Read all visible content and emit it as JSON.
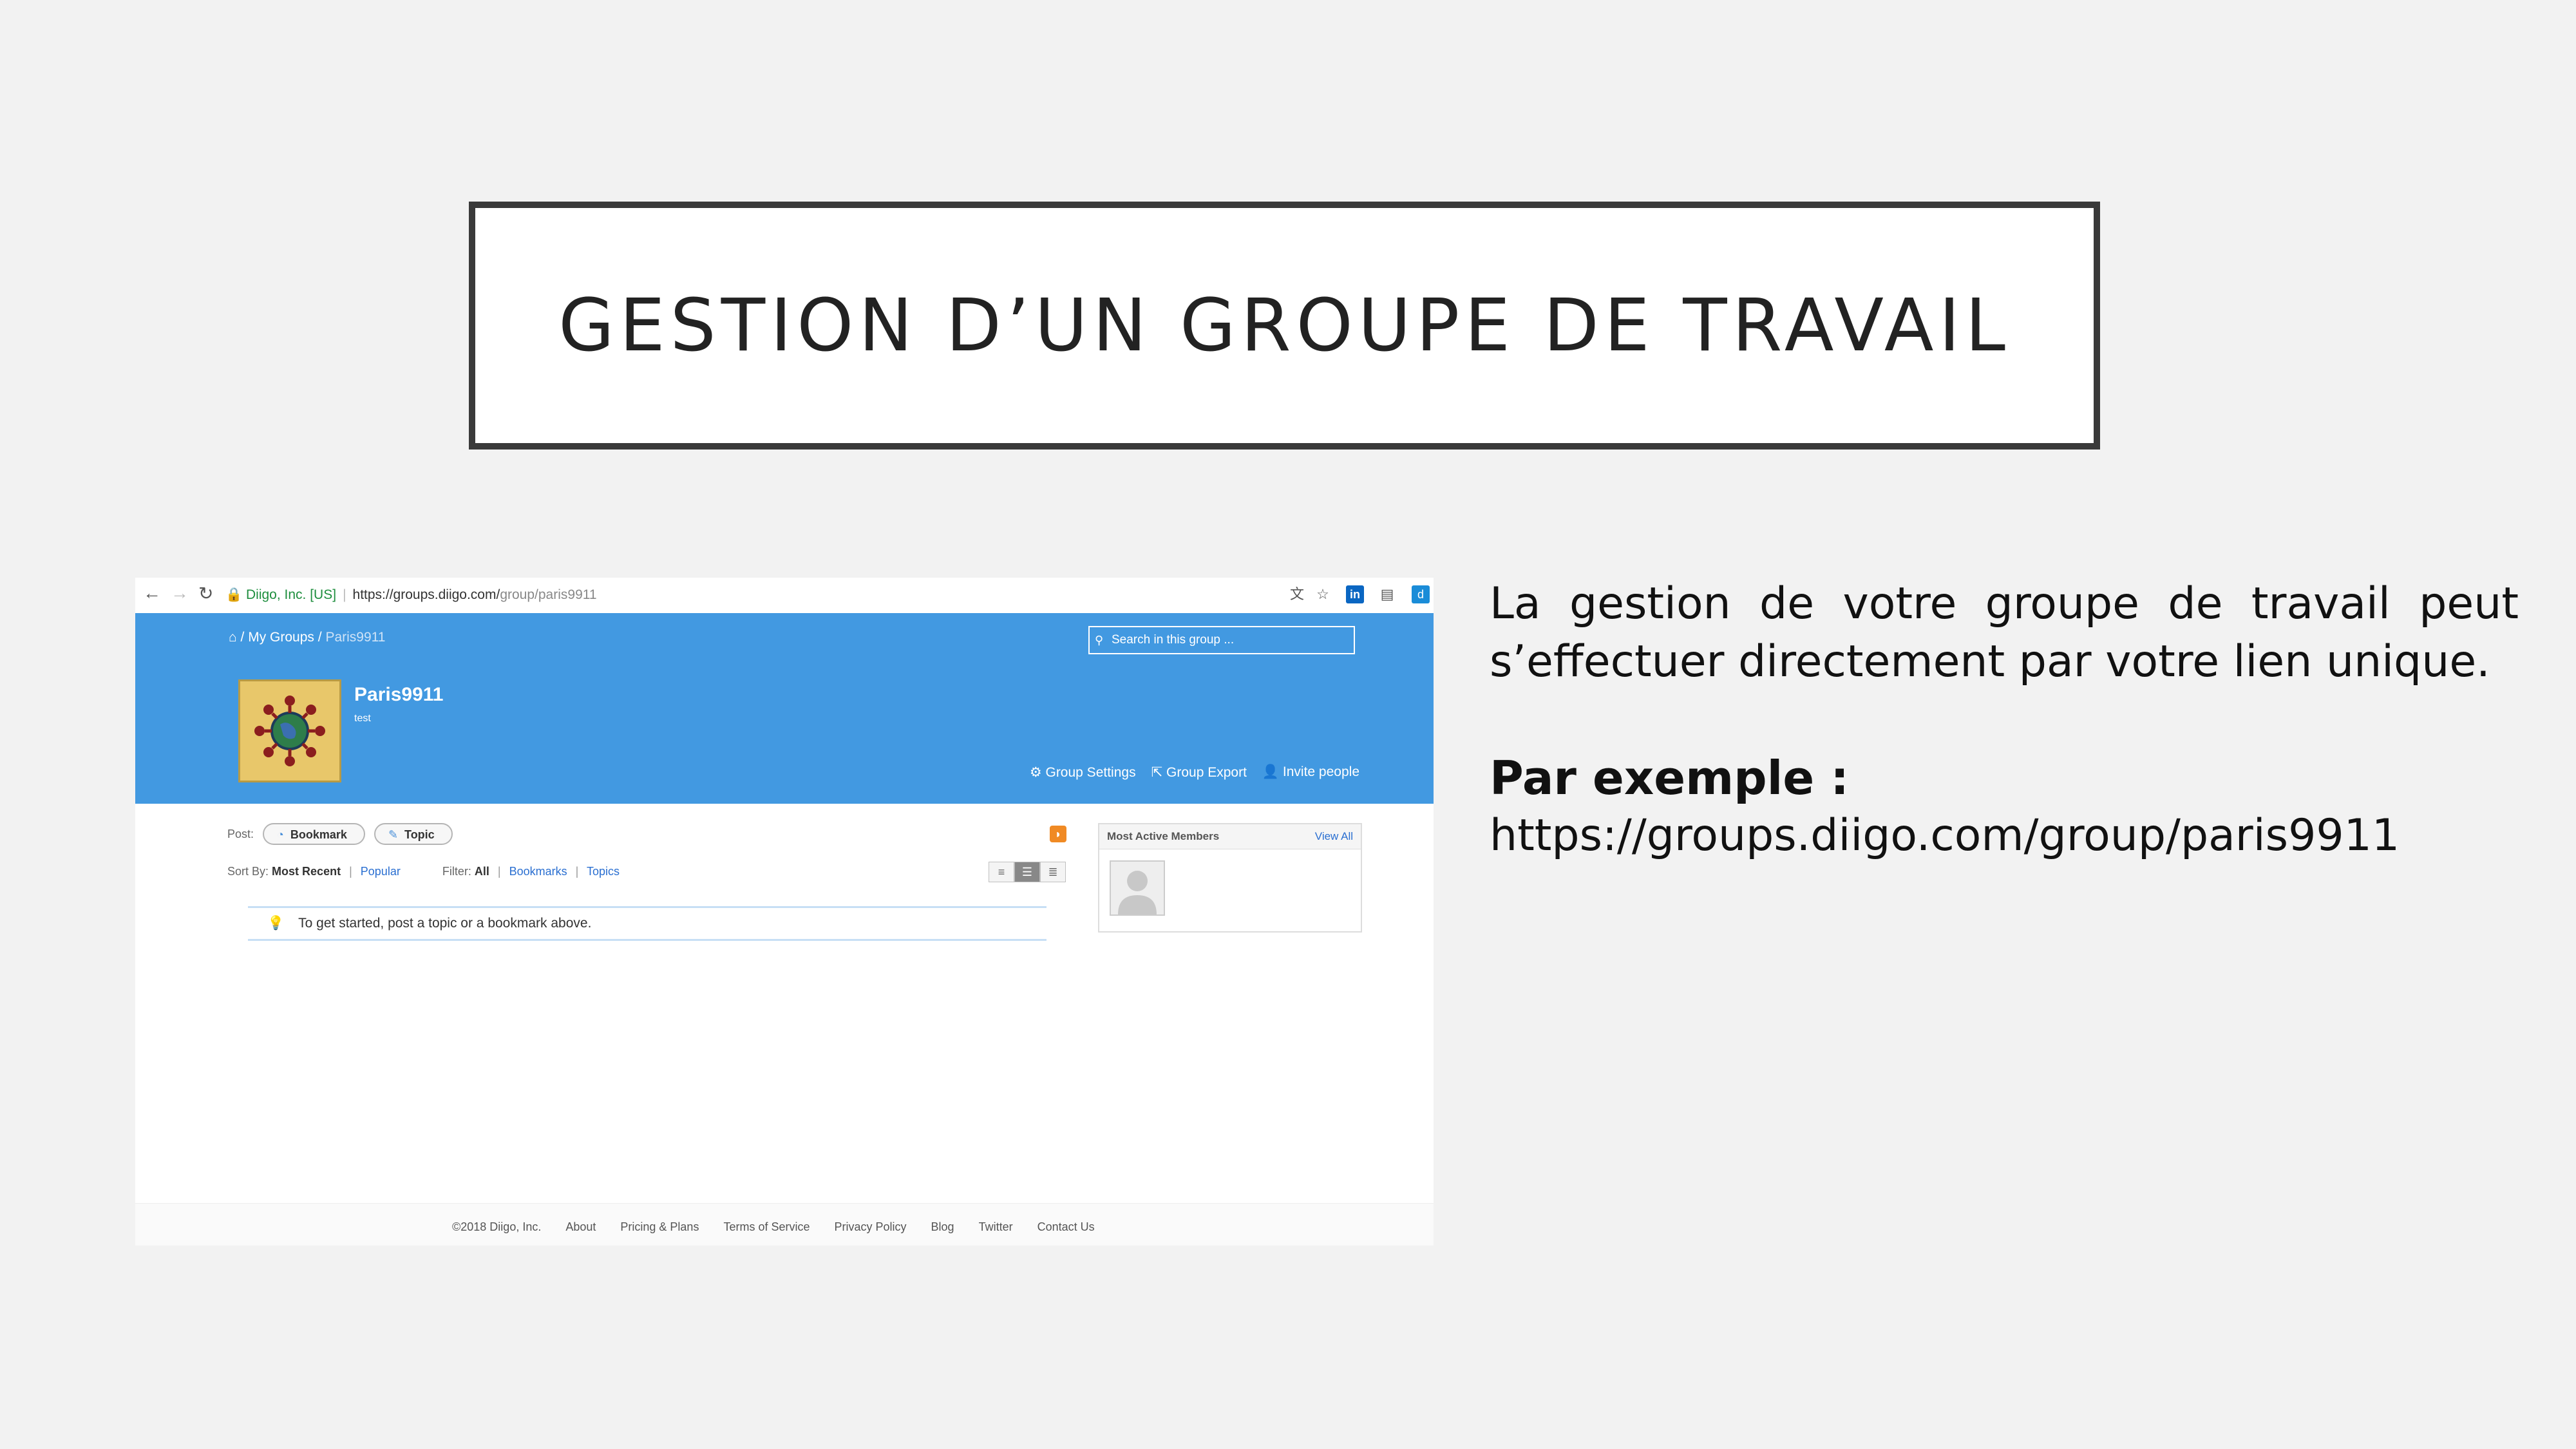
{
  "slide": {
    "title": "GESTION D’UN GROUPE DE TRAVAIL",
    "description": "La gestion de votre groupe de travail peut s’effectuer directement par votre lien unique.",
    "example_label": "Par exemple :",
    "example_url": "https://groups.diigo.com/group/paris9911"
  },
  "browser": {
    "org": "Diigo, Inc. [US]",
    "url_host": "https://groups.diigo.com/",
    "url_path": "group/paris9911"
  },
  "group": {
    "breadcrumb_sep": "/",
    "breadcrumb_mygroups": "My Groups",
    "breadcrumb_current": "Paris9911",
    "search_placeholder": "Search in this group ...",
    "name": "Paris9911",
    "description": "test",
    "actions": {
      "settings": "Group Settings",
      "export": "Group Export",
      "invite": "Invite people"
    }
  },
  "main": {
    "post_label": "Post:",
    "bookmark_btn": "Bookmark",
    "topic_btn": "Topic",
    "sort_label": "Sort By:",
    "sort_recent": "Most Recent",
    "sort_popular": "Popular",
    "filter_label": "Filter:",
    "filter_all": "All",
    "filter_bookmarks": "Bookmarks",
    "filter_topics": "Topics",
    "notice": "To get started, post a topic or a bookmark above.",
    "members_title": "Most Active Members",
    "members_viewall": "View All"
  },
  "footer": {
    "copyright": "©2018 Diigo, Inc.",
    "about": "About",
    "pricing": "Pricing & Plans",
    "terms": "Terms of Service",
    "privacy": "Privacy Policy",
    "blog": "Blog",
    "twitter": "Twitter",
    "contact": "Contact Us"
  },
  "colors": {
    "banner": "#4299e1",
    "link": "#2a6fd1",
    "title_border": "#3a3a3a"
  }
}
